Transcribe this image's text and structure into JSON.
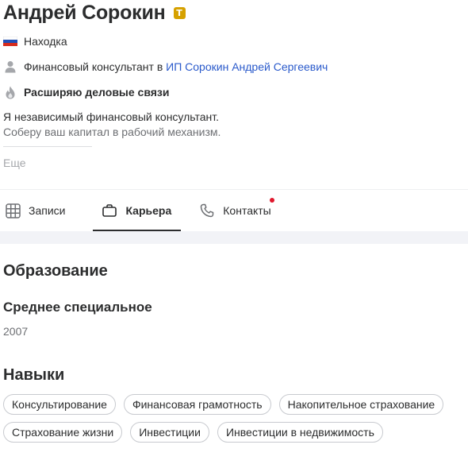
{
  "profile": {
    "name": "Андрей Сорокин",
    "badge_letter": "T",
    "badge_color": "#d6a100",
    "city": "Находка",
    "city_icon": "russia-flag-icon",
    "job_title": "Финансовый консультант",
    "job_preposition": "в",
    "company": "ИП Сорокин Андрей Сергеевич",
    "company_color": "#2a5acb",
    "job_icon": "person-icon",
    "goal": "Расширяю деловые связи",
    "goal_icon": "flame-icon",
    "about_line1": "Я независимый финансовый консультант.",
    "about_line2": "Соберу ваш капитал в рабочий механизм.",
    "more": "Еще"
  },
  "tabs": [
    {
      "label": "Записи",
      "icon": "grid-icon",
      "active": false
    },
    {
      "label": "Карьера",
      "icon": "briefcase-icon",
      "active": true
    },
    {
      "label": "Контакты",
      "icon": "phone-icon",
      "active": false,
      "has_notification": true
    }
  ],
  "education": {
    "title": "Образование",
    "level": "Среднее специальное",
    "year": "2007"
  },
  "skills": {
    "title": "Навыки",
    "items": [
      "Консультирование",
      "Финансовая грамотность",
      "Накопительное страхование",
      "Страхование жизни",
      "Инвестиции",
      "Инвестиции в недвижимость"
    ]
  }
}
